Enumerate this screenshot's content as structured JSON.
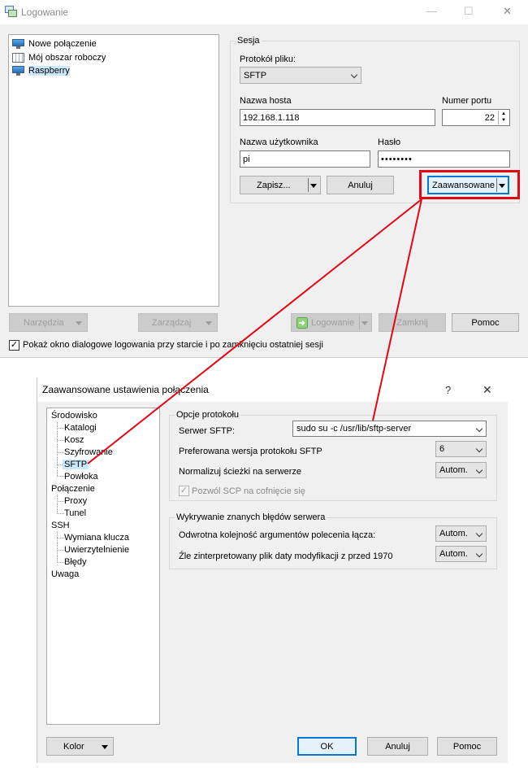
{
  "login": {
    "title": "Logowanie",
    "window_controls": {
      "minimize": "—",
      "maximize": "☐",
      "close": "✕"
    },
    "sites": [
      {
        "label": "Nowe połączenie",
        "icon": "monitor-icon"
      },
      {
        "label": "Mój obszar roboczy",
        "icon": "workspace-icon"
      },
      {
        "label": "Raspberry",
        "icon": "monitor-icon"
      }
    ],
    "session": {
      "group_label": "Sesja",
      "protocol_label": "Protokół pliku:",
      "protocol_value": "SFTP",
      "host_label": "Nazwa hosta",
      "host_value": "192.168.1.118",
      "port_label": "Numer portu",
      "port_value": "22",
      "user_label": "Nazwa użytkownika",
      "user_value": "pi",
      "password_label": "Hasło",
      "password_value": "••••••••",
      "save_button": "Zapisz...",
      "cancel_button": "Anuluj",
      "advanced_button": "Zaawansowane"
    },
    "bottom_buttons": {
      "tools": "Narzędzia",
      "manage": "Zarządzaj",
      "login": "Logowanie",
      "close": "Zamknij",
      "help": "Pomoc"
    },
    "show_dialog_checkbox": "Pokaż okno dialogowe logowania przy starcie i po zamknięciu ostatniej sesji",
    "show_dialog_checked": true
  },
  "advanced": {
    "title": "Zaawansowane ustawienia połączenia",
    "help_glyph": "?",
    "close_glyph": "✕",
    "tree": {
      "environment": "Środowisko",
      "env_children": [
        "Katalogi",
        "Kosz",
        "Szyfrowanie",
        "SFTP",
        "Powłoka"
      ],
      "connection": "Połączenie",
      "conn_children": [
        "Proxy",
        "Tunel"
      ],
      "ssh": "SSH",
      "ssh_children": [
        "Wymiana klucza",
        "Uwierzytelnienie",
        "Błędy"
      ],
      "note": "Uwaga",
      "selected": "SFTP"
    },
    "protocol_options": {
      "group_label": "Opcje protokołu",
      "sftp_server_label": "Serwer SFTP:",
      "sftp_server_value": "sudo su -c /usr/lib/sftp-server",
      "preferred_version_label": "Preferowana wersja protokołu SFTP",
      "preferred_version_value": "6",
      "normalize_label": "Normalizuj ścieżki na serwerze",
      "normalize_value": "Autom.",
      "allow_scp_label": "Pozwól SCP na cofnięcie się",
      "allow_scp_checked": true
    },
    "server_bugs": {
      "group_label": "Wykrywanie znanych błędów serwera",
      "reverse_args_label": "Odwrotna kolejność argumentów polecenia łącza:",
      "reverse_args_value": "Autom.",
      "misinterpreted_label": "Źle zinterpretowany plik daty modyfikacji z przed 1970",
      "misinterpreted_value": "Autom."
    },
    "buttons": {
      "color": "Kolor",
      "ok": "OK",
      "cancel": "Anuluj",
      "help": "Pomoc"
    }
  },
  "annotation_color": "#e30613"
}
